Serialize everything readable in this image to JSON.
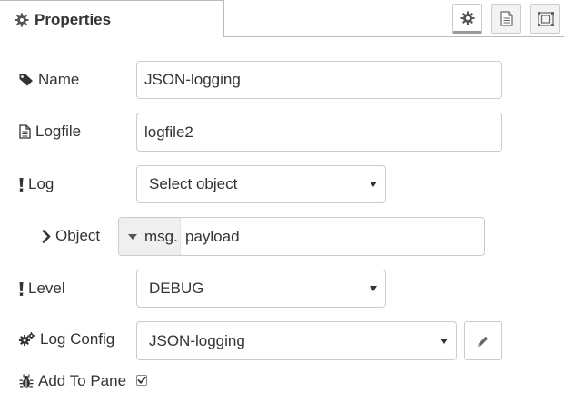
{
  "tab": {
    "label": "Properties",
    "icon": "gear-icon"
  },
  "header_buttons": [
    {
      "name": "settings-tab-button",
      "icon": "gear-icon"
    },
    {
      "name": "description-tab-button",
      "icon": "document-icon"
    },
    {
      "name": "appearance-tab-button",
      "icon": "frame-icon"
    }
  ],
  "form": {
    "name": {
      "label": "Name",
      "icon": "tag-icon",
      "value": "JSON-logging"
    },
    "logfile": {
      "label": "Logfile",
      "icon": "file-icon",
      "value": "logfile2"
    },
    "log": {
      "label": "Log",
      "icon": "exclamation-icon",
      "selected": "Select object"
    },
    "object": {
      "label": "Object",
      "icon": "chevron-right-icon",
      "type_prefix": "msg.",
      "value": "payload"
    },
    "level": {
      "label": "Level",
      "icon": "exclamation-icon",
      "selected": "DEBUG"
    },
    "log_config": {
      "label": "Log Config",
      "icon": "gears-icon",
      "selected": "JSON-logging",
      "edit_icon": "pencil-icon"
    },
    "add_to_pane": {
      "label": "Add To Pane",
      "icon": "bug-icon",
      "checked": true
    }
  }
}
